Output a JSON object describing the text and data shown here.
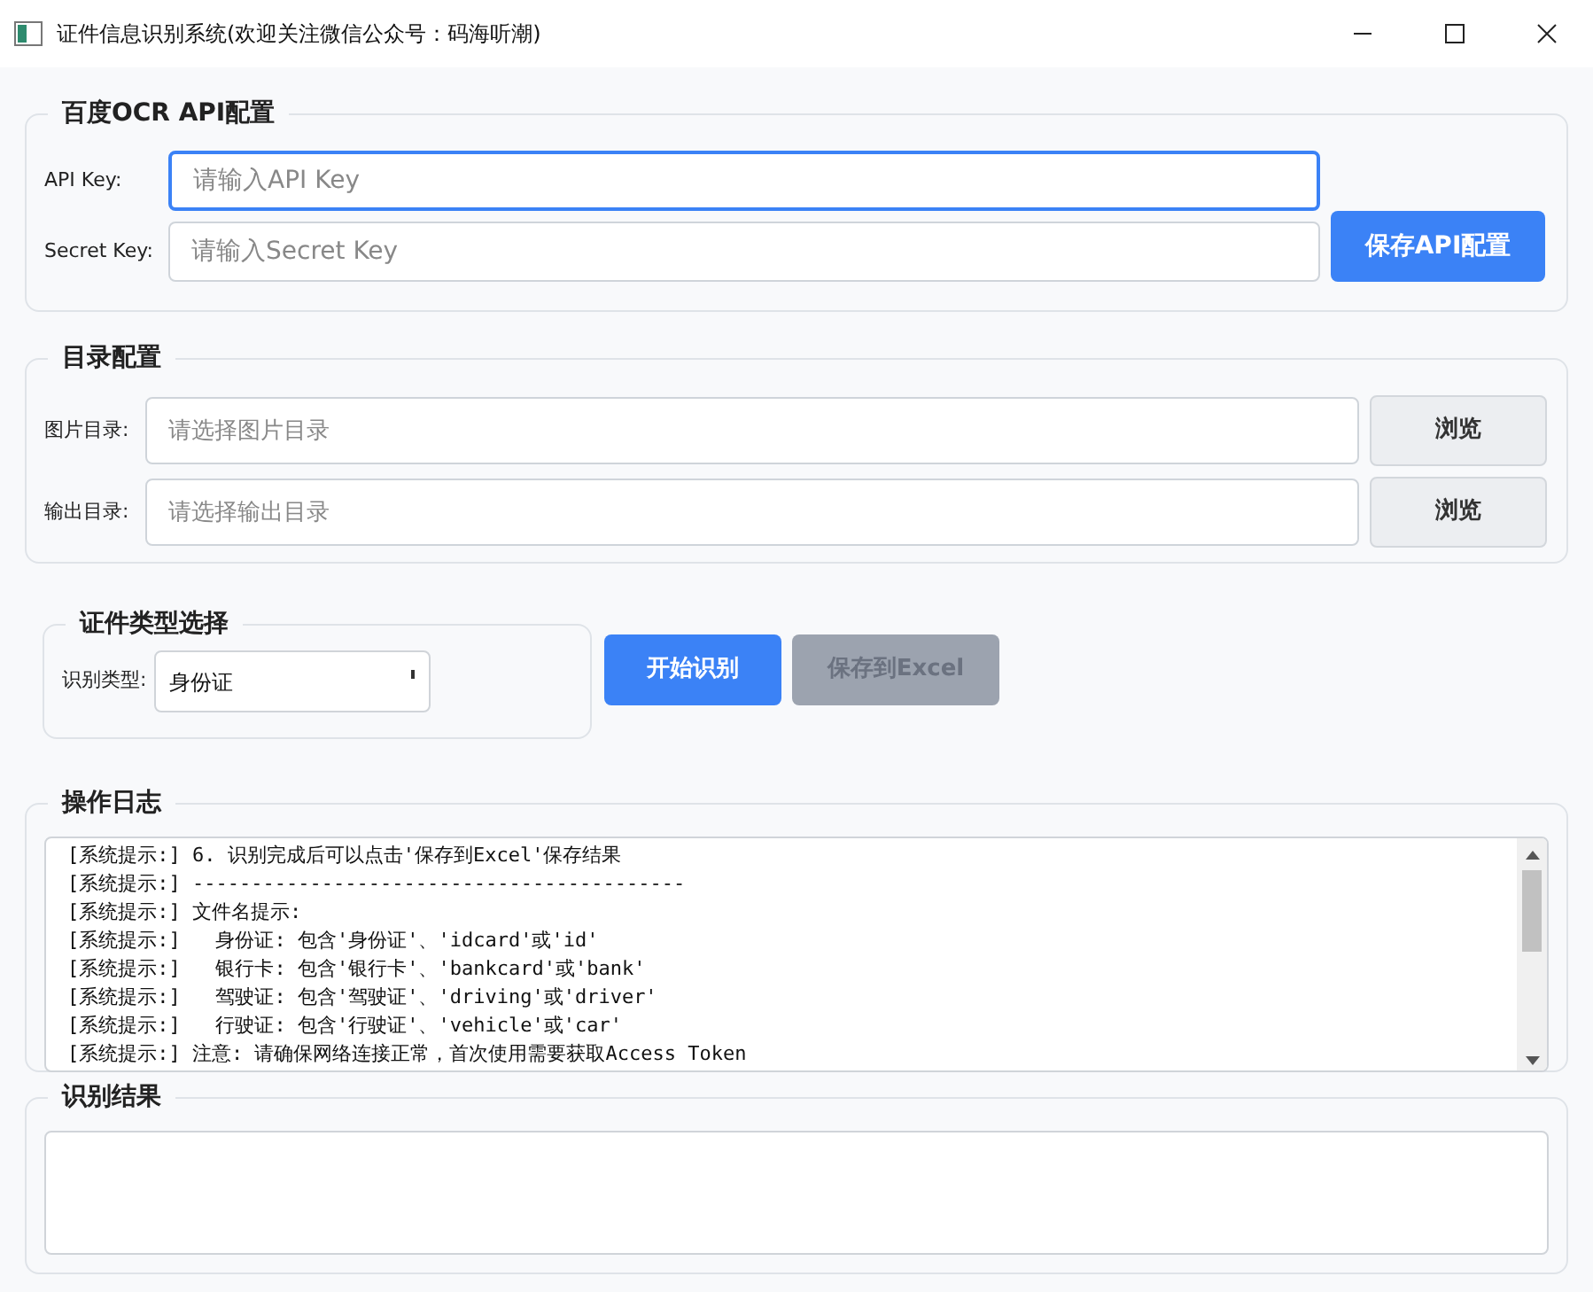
{
  "window": {
    "title": "证件信息识别系统(欢迎关注微信公众号：码海听潮)"
  },
  "api_group": {
    "title": "百度OCR API配置",
    "fields": [
      {
        "label": "API Key:",
        "placeholder": "请输入API Key",
        "focused": true
      },
      {
        "label": "Secret Key:",
        "placeholder": "请输入Secret Key",
        "focused": false
      }
    ],
    "save_button": "保存API配置"
  },
  "dir_group": {
    "title": "目录配置",
    "rows": [
      {
        "label": "图片目录:",
        "placeholder": "请选择图片目录",
        "button": "浏览"
      },
      {
        "label": "输出目录:",
        "placeholder": "请选择输出目录",
        "button": "浏览"
      }
    ]
  },
  "type_group": {
    "title": "证件类型选择",
    "label": "识别类型:",
    "value": "身份证"
  },
  "actions": [
    {
      "label": "开始识别",
      "disabled": false
    },
    {
      "label": "保存到Excel",
      "disabled": true
    }
  ],
  "log": {
    "title": "操作日志",
    "lines": [
      "[系统提示:] 6. 识别完成后可以点击'保存到Excel'保存结果",
      "[系统提示:] ------------------------------------------",
      "[系统提示:] 文件名提示:",
      "[系统提示:]   身份证: 包含'身份证'、'idcard'或'id'",
      "[系统提示:]   银行卡: 包含'银行卡'、'bankcard'或'bank'",
      "[系统提示:]   驾驶证: 包含'驾驶证'、'driving'或'driver'",
      "[系统提示:]   行驶证: 包含'行驶证'、'vehicle'或'car'",
      "[系统提示:] 注意: 请确保网络连接正常，首次使用需要获取Access Token"
    ]
  },
  "result": {
    "title": "识别结果"
  }
}
